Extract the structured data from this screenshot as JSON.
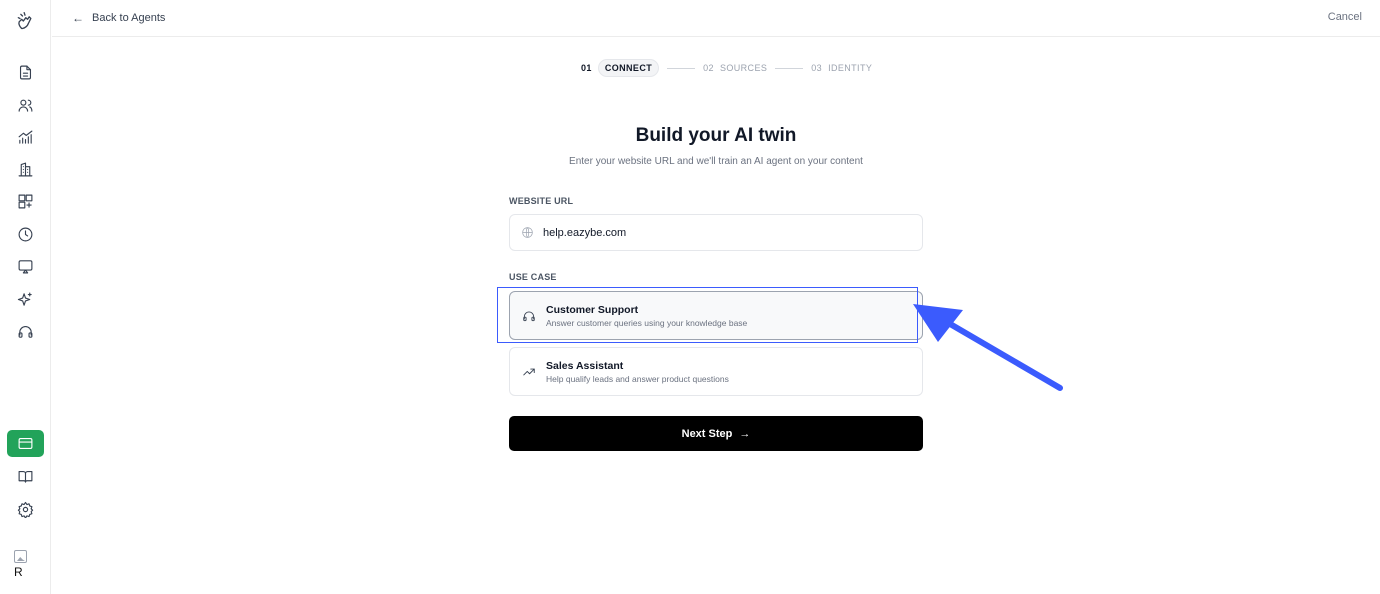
{
  "topbar": {
    "back_label": "Back to Agents",
    "back_arrow": "←",
    "cancel_label": "Cancel"
  },
  "steps": [
    {
      "num": "01",
      "name": "CONNECT",
      "current": true
    },
    {
      "num": "02",
      "name": "SOURCES",
      "current": false
    },
    {
      "num": "03",
      "name": "IDENTITY",
      "current": false
    }
  ],
  "main": {
    "title": "Build your AI twin",
    "subtitle": "Enter your website URL and we'll train an AI agent on your content",
    "website_label": "WEBSITE URL",
    "website_value": "help.eazybe.com",
    "use_case_label": "USE CASE",
    "options": [
      {
        "title": "Customer Support",
        "description": "Answer customer queries using your knowledge base",
        "icon": "headphones-icon",
        "selected": true
      },
      {
        "title": "Sales Assistant",
        "description": "Help qualify leads and answer product questions",
        "icon": "trending-up-icon",
        "selected": false
      }
    ],
    "next_label": "Next Step",
    "next_arrow": "→"
  },
  "sidebar": {
    "items": [
      "logo-icon",
      "document-icon",
      "users-icon",
      "analytics-icon",
      "building-icon",
      "grid-add-icon",
      "clock-icon",
      "screen-icon",
      "sparkles-icon",
      "headphones-icon",
      "card-icon",
      "book-icon",
      "settings-icon"
    ],
    "active_item": "card-icon",
    "avatar_initial": "R"
  },
  "colors": {
    "accent_green": "#22a35a",
    "annotation_blue": "#3b5bfd",
    "button_black": "#000000"
  }
}
